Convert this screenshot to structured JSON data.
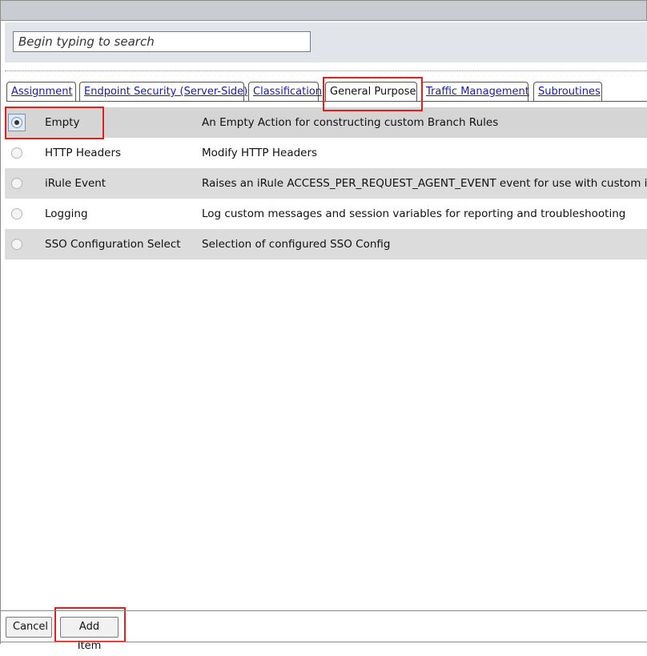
{
  "search": {
    "placeholder": "Begin typing to search"
  },
  "tabs": [
    {
      "label": "Assignment",
      "active": false
    },
    {
      "label": "Endpoint Security (Server-Side)",
      "active": false
    },
    {
      "label": "Classification",
      "active": false
    },
    {
      "label": "General Purpose",
      "active": true
    },
    {
      "label": "Traffic Management",
      "active": false
    },
    {
      "label": "Subroutines",
      "active": false
    }
  ],
  "items": [
    {
      "name": "Empty",
      "description": "An Empty Action for constructing custom Branch Rules",
      "selected": true
    },
    {
      "name": "HTTP Headers",
      "description": "Modify HTTP Headers",
      "selected": false
    },
    {
      "name": "iRule Event",
      "description": "Raises an iRule ACCESS_PER_REQUEST_AGENT_EVENT event for use with custom iRules",
      "selected": false
    },
    {
      "name": "Logging",
      "description": "Log custom messages and session variables for reporting and troubleshooting",
      "selected": false
    },
    {
      "name": "SSO Configuration Select",
      "description": "Selection of configured SSO Config",
      "selected": false
    }
  ],
  "footer": {
    "cancel_label": "Cancel",
    "add_label": "Add Item"
  },
  "colors": {
    "highlight": "#e0201e",
    "link": "#1a1aa6",
    "row_shade": "#dcdcdc"
  }
}
